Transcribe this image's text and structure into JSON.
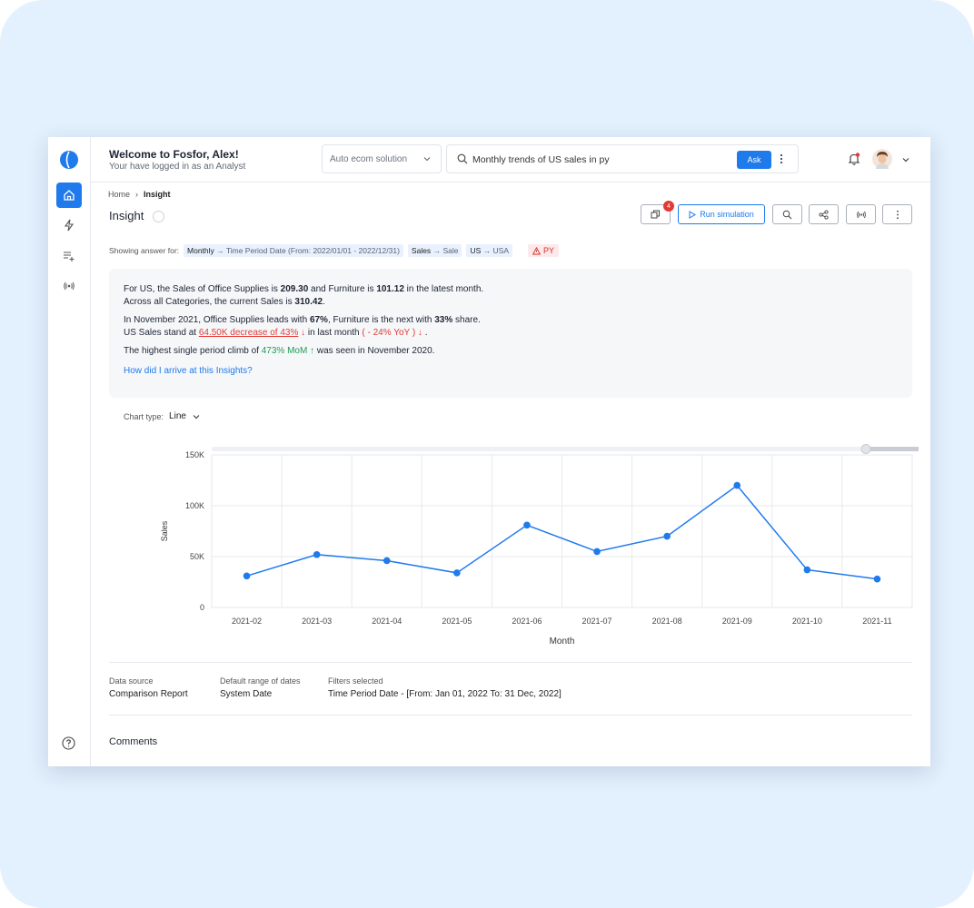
{
  "header": {
    "welcome": "Welcome to Fosfor, Alex!",
    "subtitle": "Your have logged in as an Analyst",
    "solution": "Auto ecom solution",
    "search_value": "Monthly trends of US sales in py",
    "ask_label": "Ask"
  },
  "breadcrumb": {
    "home": "Home",
    "current": "Insight"
  },
  "page": {
    "title": "Insight"
  },
  "toolbar": {
    "badge_count": "4",
    "run_label": "Run simulation"
  },
  "showing": {
    "label": "Showing answer for:",
    "chip1_a": "Monthly",
    "chip1_b": "Time Period Date (From: 2022/01/01 - 2022/12/31)",
    "chip2_a": "Sales",
    "chip2_b": "Sale",
    "chip3_a": "US",
    "chip3_b": "USA",
    "py": "PY"
  },
  "insight": {
    "l1_a": "For US, the Sales of Office Supplies is ",
    "l1_b": "209.30",
    "l1_c": " and Furniture is ",
    "l1_d": "101.12",
    "l1_e": " in the latest month.",
    "l2_a": "Across all Categories, the current Sales is ",
    "l2_b": "310.42",
    "l2_c": ".",
    "l3_a": "In November 2021, Office Supplies leads with ",
    "l3_b": "67%",
    "l3_c": ", Furniture is the next with ",
    "l3_d": "33%",
    "l3_e": " share.",
    "l4_a": "US Sales stand at ",
    "l4_b": "64.50K decrease of 43%",
    "l4_c": " ↓",
    "l4_d": " in last month ",
    "l4_e": "( - 24% YoY ) ↓",
    "l4_f": " .",
    "l5_a": "The highest single period climb of ",
    "l5_b": "473% MoM ↑",
    "l5_c": " was seen in November 2020.",
    "link": "How did I arrive at this Insights?"
  },
  "chart_type": {
    "label": "Chart type:",
    "value": "Line"
  },
  "chart_data": {
    "type": "line",
    "categories": [
      "2021-02",
      "2021-03",
      "2021-04",
      "2021-05",
      "2021-06",
      "2021-07",
      "2021-08",
      "2021-09",
      "2021-10",
      "2021-11"
    ],
    "values": [
      31000,
      52000,
      46000,
      34000,
      81000,
      55000,
      70000,
      120000,
      37000,
      28000
    ],
    "xlabel": "Month",
    "ylabel": "Sales",
    "ylim": [
      0,
      150000
    ],
    "yticks": [
      0,
      50000,
      100000,
      150000
    ],
    "ytick_labels": [
      "0",
      "50K",
      "100K",
      "150K"
    ],
    "grid": true,
    "color": "#1f7aec"
  },
  "meta": {
    "source_label": "Data source",
    "source_value": "Comparison Report",
    "range_label": "Default range of dates",
    "range_value": "System Date",
    "filters_label": "Filters selected",
    "filters_value": "Time Period Date - [From: Jan 01, 2022 To: 31 Dec, 2022]"
  },
  "comments": {
    "title": "Comments"
  }
}
